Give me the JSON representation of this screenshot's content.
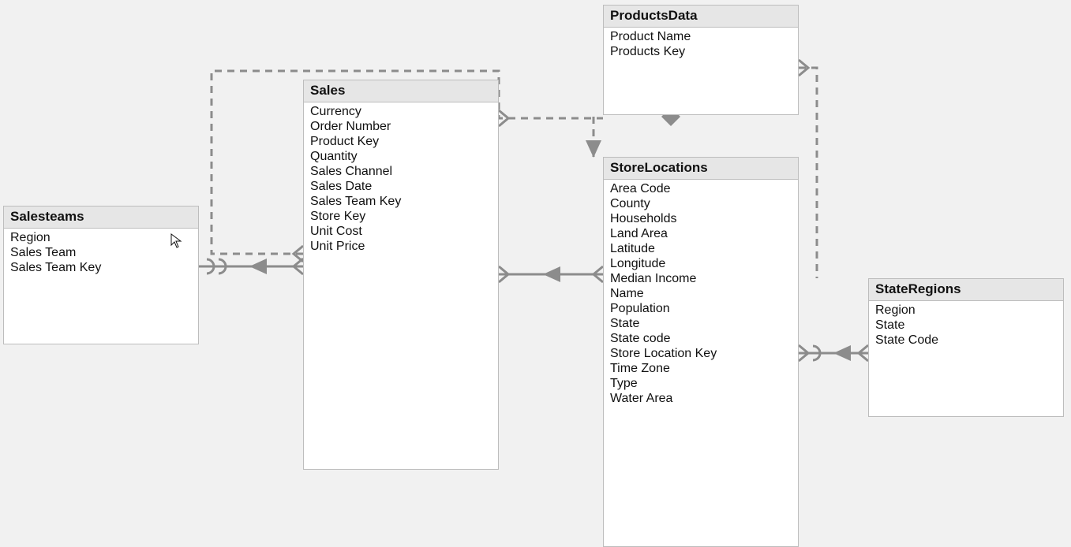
{
  "diagram": {
    "tables": {
      "salesteams": {
        "title": "Salesteams",
        "fields": [
          "Region",
          "Sales Team",
          "Sales Team Key"
        ]
      },
      "sales": {
        "title": "Sales",
        "fields": [
          "Currency",
          "Order Number",
          "Product Key",
          "Quantity",
          "Sales Channel",
          "Sales Date",
          "Sales Team Key",
          "Store Key",
          "Unit Cost",
          "Unit Price"
        ]
      },
      "productsdata": {
        "title": "ProductsData",
        "fields": [
          "Product Name",
          "Products Key"
        ]
      },
      "storelocations": {
        "title": "StoreLocations",
        "fields": [
          "Area Code",
          "County",
          "Households",
          "Land Area",
          "Latitude",
          "Longitude",
          "Median Income",
          "Name",
          "Population",
          "State",
          "State code",
          "Store Location Key",
          "Time Zone",
          "Type",
          "Water Area"
        ]
      },
      "stateregions": {
        "title": "StateRegions",
        "fields": [
          "Region",
          "State",
          "State Code"
        ]
      }
    },
    "relationships": [
      {
        "from": "salesteams",
        "to": "sales",
        "active": true
      },
      {
        "from": "sales",
        "to": "storelocations",
        "active": true
      },
      {
        "from": "storelocations",
        "to": "stateregions",
        "active": true
      },
      {
        "from": "sales",
        "to": "productsdata",
        "active": false
      },
      {
        "from": "productsdata",
        "to": "storelocations",
        "active": false
      },
      {
        "from": "productsdata",
        "to": "stateregions",
        "active": false
      }
    ]
  }
}
